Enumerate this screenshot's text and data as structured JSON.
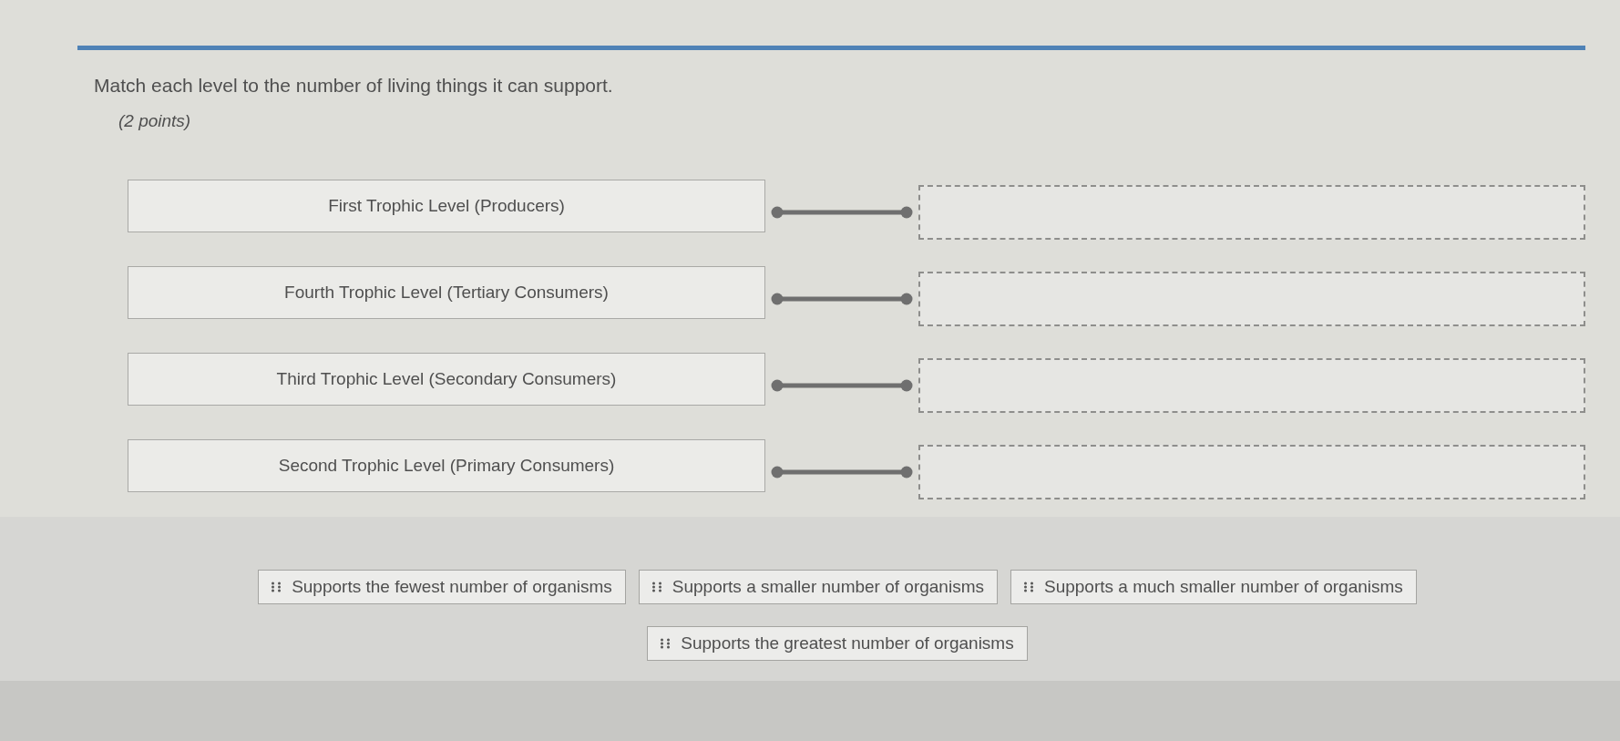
{
  "question": {
    "prompt": "Match each level to the number of living things it can support.",
    "points": "(2 points)"
  },
  "pairs": [
    {
      "term": "First Trophic Level (Producers)"
    },
    {
      "term": "Fourth Trophic Level (Tertiary Consumers)"
    },
    {
      "term": "Third Trophic Level (Secondary Consumers)"
    },
    {
      "term": "Second Trophic Level (Primary Consumers)"
    }
  ],
  "choices": [
    {
      "label": "Supports the fewest number of organisms"
    },
    {
      "label": "Supports a smaller number of organisms"
    },
    {
      "label": "Supports a much smaller number of organisms"
    },
    {
      "label": "Supports the greatest number of organisms"
    }
  ]
}
